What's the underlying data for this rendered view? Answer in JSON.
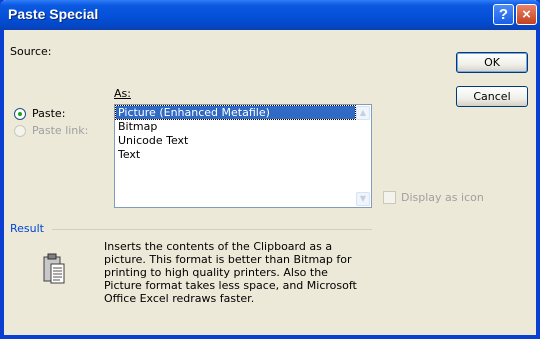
{
  "window": {
    "title": "Paste Special",
    "help_button": "?",
    "close_button": "×"
  },
  "source": {
    "label": "Source:"
  },
  "paste_options": {
    "paste_label": "Paste:",
    "paste_link_label": "Paste link:",
    "selected": "Paste"
  },
  "as": {
    "label": "As:",
    "items": [
      "Picture (Enhanced Metafile)",
      "Bitmap",
      "Unicode Text",
      "Text"
    ],
    "selected_index": 0
  },
  "display_as_icon": {
    "label": "Display as icon",
    "checked": false
  },
  "buttons": {
    "ok": "OK",
    "cancel": "Cancel"
  },
  "result": {
    "label": "Result",
    "lines": [
      "Inserts the contents of the Clipboard as a",
      "picture. This format is better than Bitmap for",
      "printing to high quality printers. Also the",
      "Picture format takes less space, and Microsoft",
      "Office Excel redraws faster."
    ]
  },
  "icons": {
    "clipboard": "clipboard-icon",
    "scroll_up": "scroll-up-arrow",
    "scroll_down": "scroll-down-arrow"
  },
  "colors": {
    "titlebar": "#0550d8",
    "dialog_bg": "#ece9d8",
    "selection": "#316ac5",
    "result_label": "#0046d5"
  }
}
